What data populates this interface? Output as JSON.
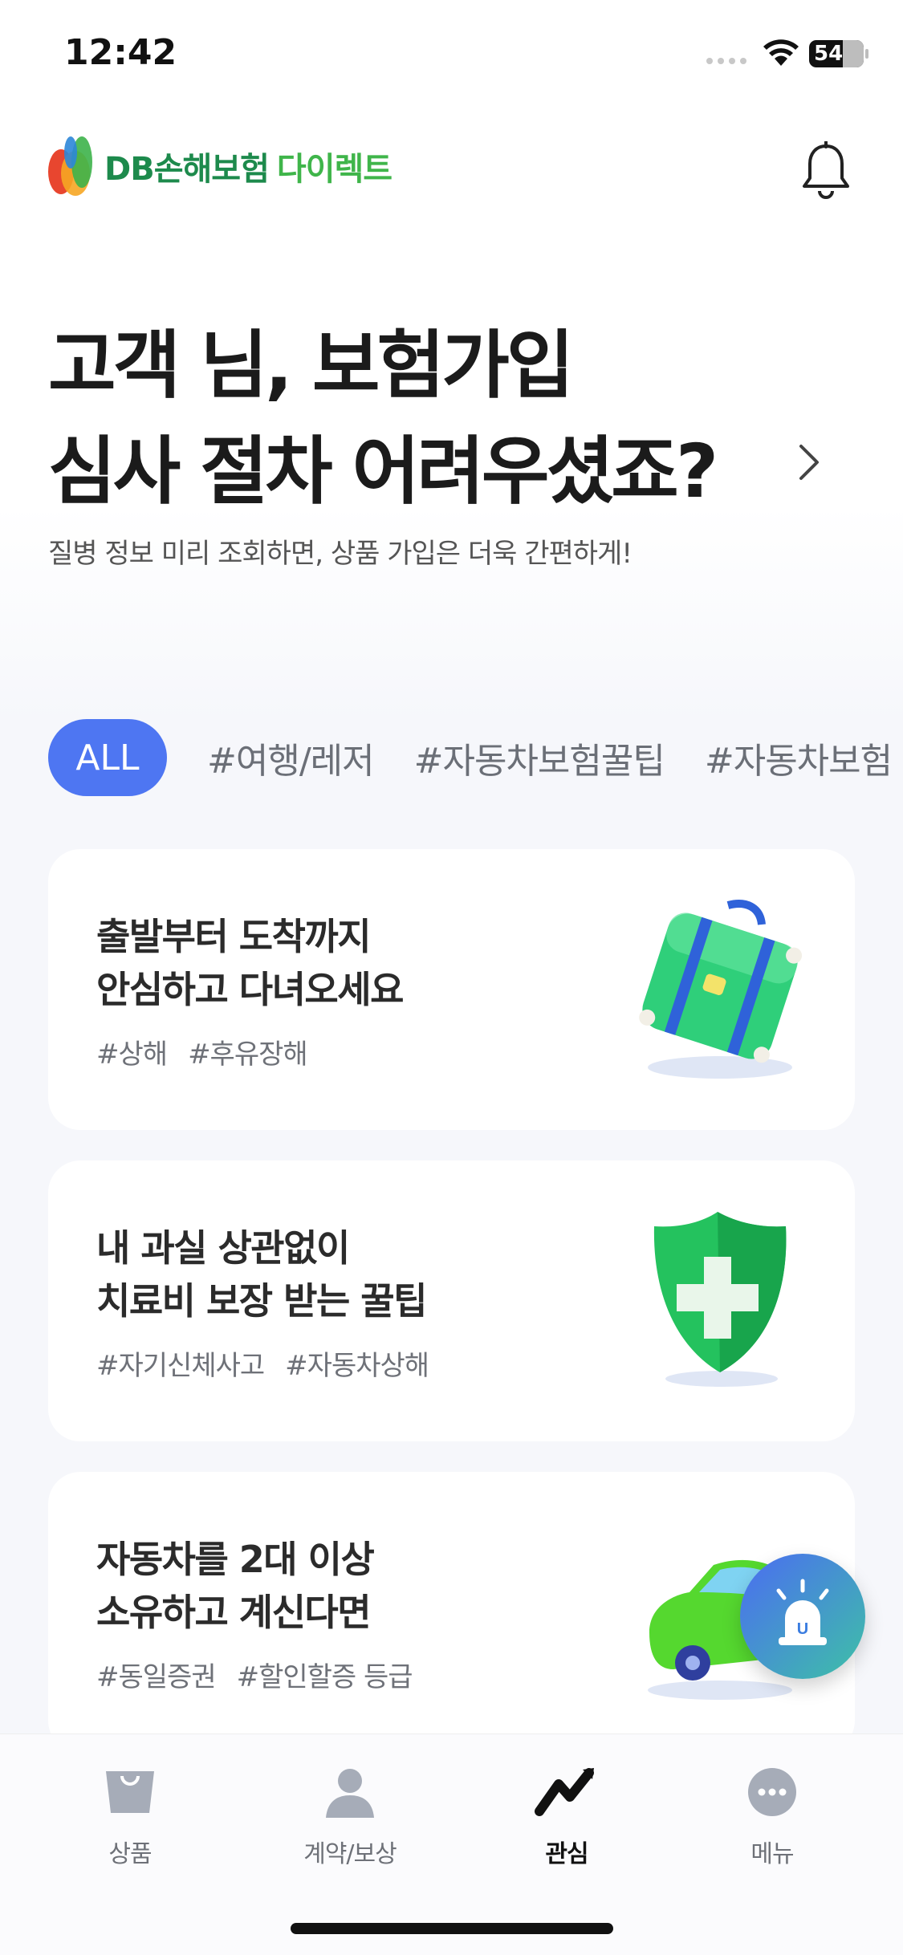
{
  "status_bar": {
    "time": "12:42",
    "battery": "54"
  },
  "header": {
    "brand": "DB손해보험",
    "brand_sub": "다이렉트"
  },
  "hero": {
    "title_line1": "고객 님, 보험가입",
    "title_line2": "심사 절차 어려우셨죠?",
    "subtitle": "질병 정보 미리 조회하면, 상품 가입은 더욱 간편하게!"
  },
  "chips": [
    "ALL",
    "#여행/레저",
    "#자동차보험꿀팁",
    "#자동차보험"
  ],
  "cards": [
    {
      "line1": "출발부터 도착까지",
      "line2": "안심하고 다녀오세요",
      "tags": [
        "#상해",
        "#후유장해"
      ]
    },
    {
      "line1": "내 과실 상관없이",
      "line2": "치료비 보장 받는 꿀팁",
      "tags": [
        "#자기신체사고",
        "#자동차상해"
      ]
    },
    {
      "line1": "자동차를 2대 이상",
      "line2": "소유하고 계신다면",
      "tags": [
        "#동일증권",
        "#할인할증 등급"
      ]
    }
  ],
  "fab": {
    "label": "U"
  },
  "tabbar": {
    "items": [
      {
        "label": "상품",
        "icon": "shopping-bag-icon"
      },
      {
        "label": "계약/보상",
        "icon": "person-icon"
      },
      {
        "label": "관심",
        "icon": "trend-icon",
        "active": true
      },
      {
        "label": "메뉴",
        "icon": "more-dots-icon"
      }
    ]
  },
  "colors": {
    "accent": "#4e76f2",
    "brand": "#1d8a4c"
  }
}
